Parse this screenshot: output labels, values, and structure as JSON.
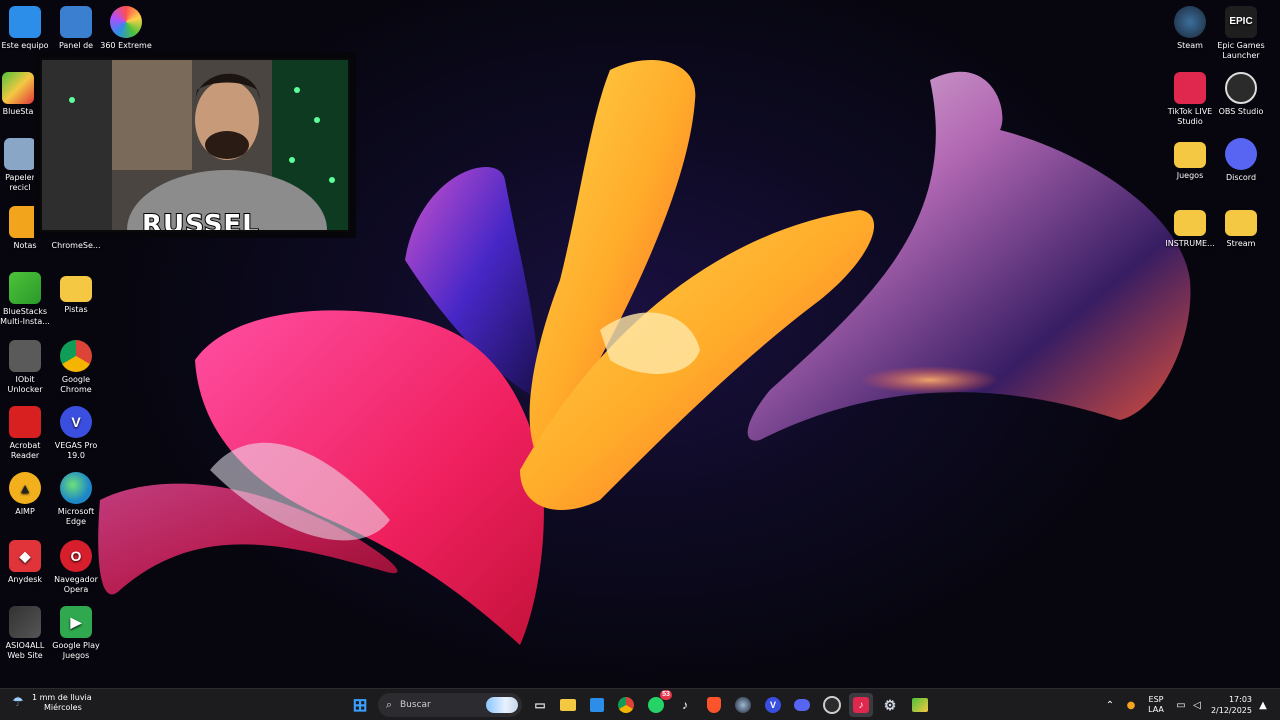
{
  "desktop_icons_left": [
    {
      "id": "este-equipo",
      "label": "Este equipo",
      "glyph": "",
      "color": "#2c8ee8"
    },
    {
      "id": "panel-de-control",
      "label": "Panel de",
      "glyph": "",
      "color": "#3a7fd0"
    },
    {
      "id": "360-extreme",
      "label": "360 Extreme",
      "glyph": "",
      "color": "#e44b8f"
    },
    {
      "id": "bluestacks",
      "label": "BlueSta",
      "glyph": "",
      "color": "#4ec23a"
    },
    {
      "id": "papelera",
      "label": "Papeler\nrecicl",
      "glyph": "",
      "color": "#8aa6c6"
    },
    {
      "id": "notas",
      "label": "Notas",
      "glyph": "",
      "color": "#f2a51c"
    },
    {
      "id": "chromesetup",
      "label": "ChromeSe...",
      "glyph": "",
      "color": "#2b2b2b"
    },
    {
      "id": "bluestacks-multi",
      "label": "BlueStacks\nMulti-Insta...",
      "glyph": "",
      "color": "#4ec23a"
    },
    {
      "id": "pistas",
      "label": "Pistas",
      "glyph": "",
      "color": "#f4c842"
    },
    {
      "id": "iobit-unlocker",
      "label": "IObit\nUnlocker",
      "glyph": "",
      "color": "#5a5a5a"
    },
    {
      "id": "google-chrome",
      "label": "Google\nChrome",
      "glyph": "",
      "color": "#db4437"
    },
    {
      "id": "acrobat-reader",
      "label": "Acrobat\nReader",
      "glyph": "",
      "color": "#d7201f"
    },
    {
      "id": "vegas-pro",
      "label": "VEGAS Pro\n19.0",
      "glyph": "V",
      "color": "#3a4fe0"
    },
    {
      "id": "aimp",
      "label": "AIMP",
      "glyph": "▲",
      "color": "#f2b01c"
    },
    {
      "id": "microsoft-edge",
      "label": "Microsoft\nEdge",
      "glyph": "",
      "color": "#1e88c6"
    },
    {
      "id": "anydesk",
      "label": "Anydesk",
      "glyph": "◆",
      "color": "#e0343a"
    },
    {
      "id": "navegador-opera",
      "label": "Navegador\nOpera",
      "glyph": "O",
      "color": "#d61e2d"
    },
    {
      "id": "asio4all",
      "label": "ASIO4ALL\nWeb Site",
      "glyph": "",
      "color": "#333333"
    },
    {
      "id": "google-play-juegos",
      "label": "Google Play\nJuegos",
      "glyph": "▶",
      "color": "#2fa84f"
    }
  ],
  "desktop_icons_right": [
    {
      "id": "steam",
      "label": "Steam",
      "glyph": "",
      "color": "#1b2838"
    },
    {
      "id": "epic-games",
      "label": "Epic Games\nLauncher",
      "glyph": "EPIC",
      "color": "#1e1e1e"
    },
    {
      "id": "tiktok-live",
      "label": "TikTok LIVE\nStudio",
      "glyph": "",
      "color": "#e0284f"
    },
    {
      "id": "obs-studio",
      "label": "OBS Studio",
      "glyph": "",
      "color": "#2b2b2b"
    },
    {
      "id": "juegos",
      "label": "Juegos",
      "glyph": "",
      "color": "#f4c842"
    },
    {
      "id": "discord",
      "label": "Discord",
      "glyph": "",
      "color": "#5865f2"
    },
    {
      "id": "instrumentales",
      "label": "INSTRUME...",
      "glyph": "",
      "color": "#f4c842"
    },
    {
      "id": "stream",
      "label": "Stream",
      "glyph": "",
      "color": "#f4c842"
    }
  ],
  "webcam": {
    "name": "RUSSEL"
  },
  "taskbar": {
    "weather": {
      "line1": "1 mm de lluvia",
      "line2": "Miércoles"
    },
    "search_placeholder": "Buscar",
    "pinned": [
      {
        "id": "start",
        "glyph": "⊞",
        "color": "#3aa0ff",
        "bg": ""
      },
      {
        "id": "task-view",
        "glyph": "▭",
        "color": "#dddddd",
        "bg": ""
      },
      {
        "id": "file-explorer",
        "glyph": "",
        "color": "#f4c842",
        "bg": "#f4c842"
      },
      {
        "id": "store",
        "glyph": "",
        "color": "#2c8ee8",
        "bg": "#2c8ee8"
      },
      {
        "id": "chrome",
        "glyph": "",
        "color": "#db4437",
        "bg": "#db4437"
      },
      {
        "id": "whatsapp",
        "glyph": "",
        "color": "#25d366",
        "bg": "#25d366",
        "badge": "53"
      },
      {
        "id": "tiktok",
        "glyph": "♪",
        "color": "#ffffff",
        "bg": "#111111"
      },
      {
        "id": "brave",
        "glyph": "",
        "color": "#fb542b",
        "bg": "#fb542b"
      },
      {
        "id": "steam",
        "glyph": "",
        "color": "#9fb7d0",
        "bg": "#1b2838"
      },
      {
        "id": "vegas",
        "glyph": "V",
        "color": "#ffffff",
        "bg": "#3a4fe0"
      },
      {
        "id": "discord",
        "glyph": "",
        "color": "#5865f2",
        "bg": "#5865f2"
      },
      {
        "id": "obs",
        "glyph": "",
        "color": "#cccccc",
        "bg": "#2b2b2b"
      },
      {
        "id": "tiktok-live",
        "glyph": "♪",
        "color": "#ffffff",
        "bg": "#e0284f"
      },
      {
        "id": "settings",
        "glyph": "⚙",
        "color": "#cfd6e0",
        "bg": ""
      },
      {
        "id": "bluestacks",
        "glyph": "",
        "color": "#4ec23a",
        "bg": "#4ec23a"
      }
    ],
    "tray": {
      "language_line1": "ESP",
      "language_line2": "LAA",
      "time": "17:03",
      "date": "2/12/2025"
    }
  }
}
